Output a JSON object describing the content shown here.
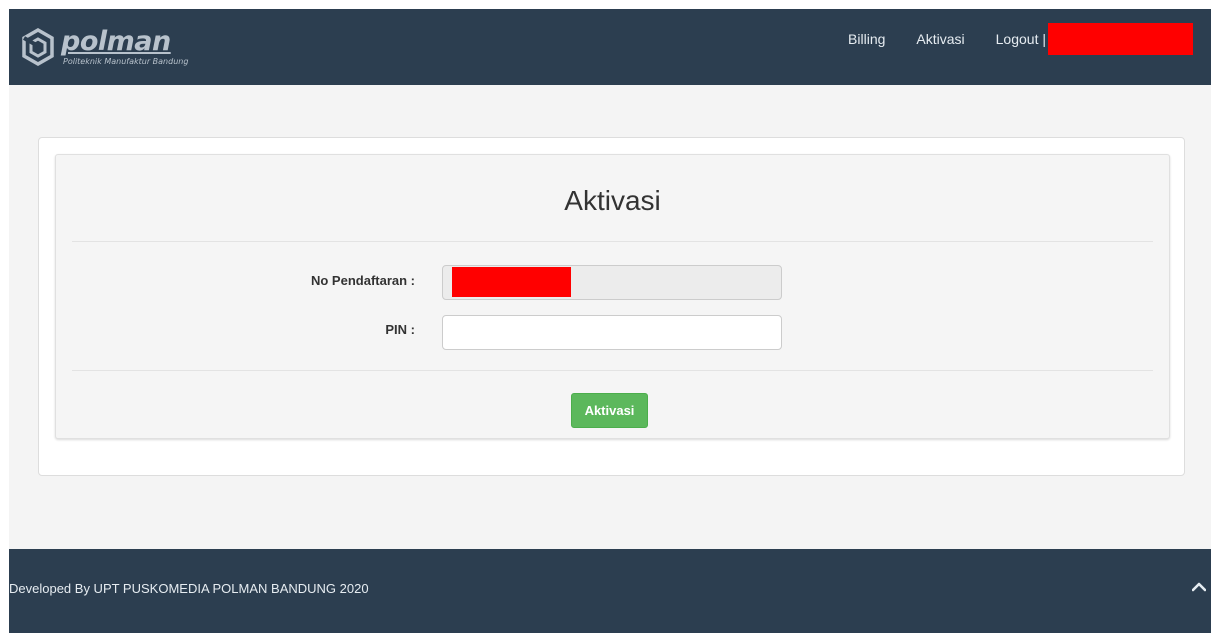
{
  "header": {
    "logo": {
      "name": "polman",
      "subtitle": "Politeknik Manufaktur Bandung"
    },
    "nav": {
      "billing": "Billing",
      "aktivasi": "Aktivasi",
      "logout": "Logout |",
      "user_redacted": ""
    }
  },
  "form": {
    "title": "Aktivasi",
    "no_pendaftaran_label": "No Pendaftaran :",
    "no_pendaftaran_value": "",
    "pin_label": "PIN :",
    "pin_value": "",
    "submit_label": "Aktivasi"
  },
  "footer": {
    "text": "Developed By UPT PUSKOMEDIA POLMAN BANDUNG 2020",
    "scroll_top_icon": "chevron-up-icon"
  },
  "colors": {
    "navbar": "#2c3e50",
    "page_background": "#f4f4f4",
    "button": "#5cb85c",
    "redaction": "#ff0000"
  }
}
